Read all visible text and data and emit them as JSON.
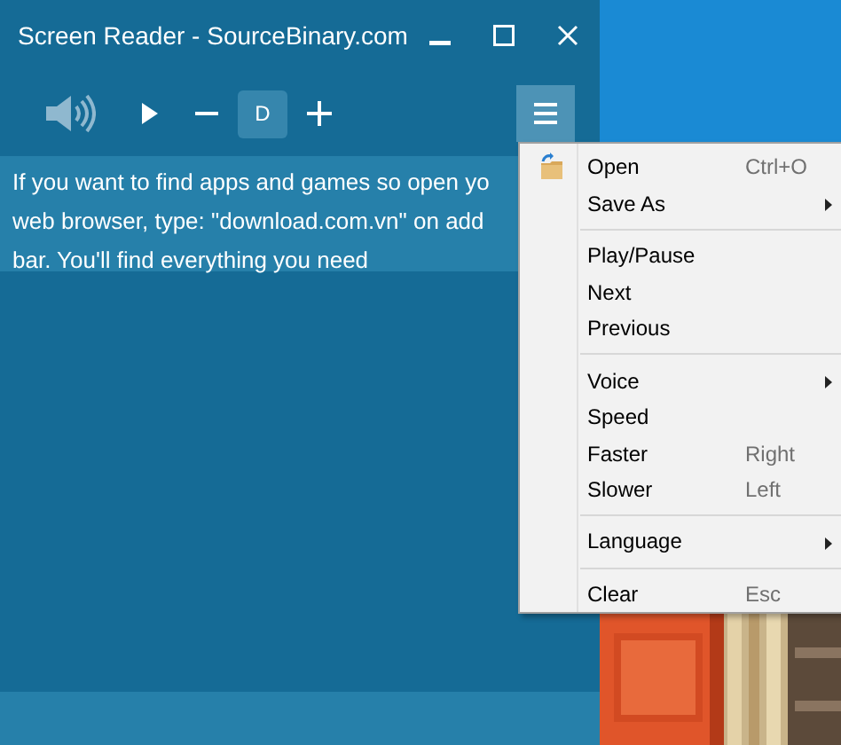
{
  "window": {
    "title": "Screen Reader - SourceBinary.com"
  },
  "toolbar": {
    "voice_letter": "D"
  },
  "text_lines": [
    "If you want to find apps and games so open yo",
    "web browser, type: \"download.com.vn\" on add",
    "bar. You'll find everything you need"
  ],
  "menu": {
    "groups": [
      [
        {
          "label": "Open",
          "shortcut": "Ctrl+O",
          "submenu": false,
          "icon": true
        },
        {
          "label": "Save As",
          "submenu": true,
          "icon": false
        }
      ],
      [
        {
          "label": "Play/Pause",
          "submenu": false,
          "icon": false
        },
        {
          "label": "Next",
          "submenu": false,
          "icon": false
        },
        {
          "label": "Previous",
          "submenu": false,
          "icon": false
        }
      ],
      [
        {
          "label": "Voice",
          "submenu": true,
          "icon": false
        },
        {
          "label": "Speed",
          "submenu": false,
          "icon": false
        },
        {
          "label": "Faster",
          "shortcut": "Right",
          "submenu": false,
          "icon": false
        },
        {
          "label": "Slower",
          "shortcut": "Left",
          "submenu": false,
          "icon": false
        }
      ],
      [
        {
          "label": "Language",
          "submenu": true,
          "icon": false
        }
      ],
      [
        {
          "label": "Clear",
          "shortcut": "Esc",
          "submenu": false,
          "icon": false
        }
      ]
    ]
  },
  "desktop": {
    "kind": "picture"
  }
}
